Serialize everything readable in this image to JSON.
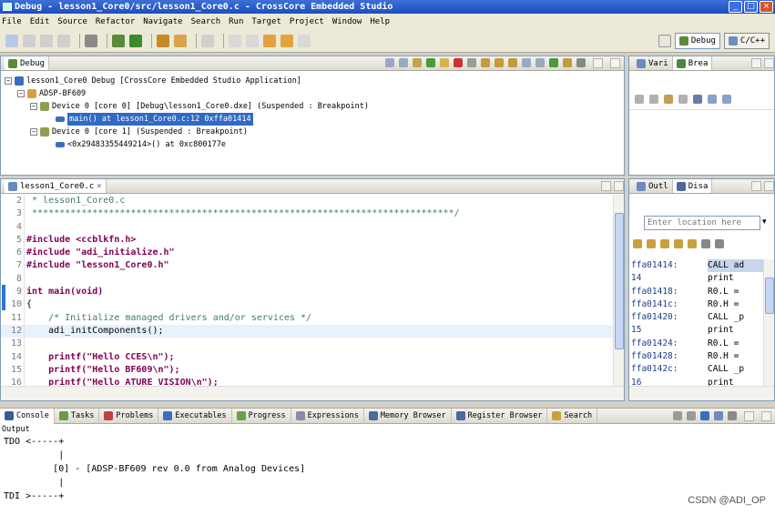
{
  "window": {
    "title": "Debug - lesson1_Core0/src/lesson1_Core0.c - CrossCore Embedded Studio",
    "controls": [
      "_",
      "□",
      "×"
    ]
  },
  "menu": [
    "File",
    "Edit",
    "Source",
    "Refactor",
    "Navigate",
    "Search",
    "Run",
    "Target",
    "Project",
    "Window",
    "Help"
  ],
  "perspectives": {
    "debug": "Debug",
    "cpp": "C/C++"
  },
  "debug_view": {
    "tab": "Debug",
    "tree": [
      "lesson1_Core0 Debug [CrossCore Embedded Studio Application]",
      "ADSP-BF609",
      "Device 0 [core 0] [Debug\\lesson1_Core0.dxe] (Suspended : Breakpoint)",
      "main() at lesson1_Core0.c:12 0xffa01414",
      "Device 0 [core 1] (Suspended : Breakpoint)",
      "<0x29483355449214>() at 0xc800177e"
    ]
  },
  "vars_view": {
    "tabs": [
      "Vari",
      "Brea"
    ]
  },
  "editor": {
    "tab": "lesson1_Core0.c",
    "lines": [
      {
        "n": "2",
        "t": " * lesson1_Core0.c"
      },
      {
        "n": "3",
        "t": " *****************************************************************************/"
      },
      {
        "n": "4",
        "t": ""
      },
      {
        "n": "5",
        "t": "#include <ccblkfn.h>"
      },
      {
        "n": "6",
        "t": "#include \"adi_initialize.h\""
      },
      {
        "n": "7",
        "t": "#include \"lesson1_Core0.h\""
      },
      {
        "n": "8",
        "t": ""
      },
      {
        "n": "9",
        "t": "int main(void)"
      },
      {
        "n": "10",
        "t": "{"
      },
      {
        "n": "11",
        "t": "    /* Initialize managed drivers and/or services */"
      },
      {
        "n": "12",
        "t": "    adi_initComponents();"
      },
      {
        "n": "13",
        "t": ""
      },
      {
        "n": "14",
        "t": "    printf(\"Hello CCES\\n\");"
      },
      {
        "n": "15",
        "t": "    printf(\"Hello BF609\\n\");"
      },
      {
        "n": "16",
        "t": "    printf(\"Hello ATURE VISION\\n\");"
      }
    ]
  },
  "side_panel": {
    "tabs": [
      "Outl",
      "Disa"
    ],
    "location_placeholder": "Enter location here",
    "rows": [
      {
        "a": "ffa01414:",
        "i": "CALL ad"
      },
      {
        "a": "14",
        "i": "print"
      },
      {
        "a": "ffa01418:",
        "i": "R0.L ="
      },
      {
        "a": "ffa0141c:",
        "i": "R0.H ="
      },
      {
        "a": "ffa01420:",
        "i": "CALL _p"
      },
      {
        "a": "15",
        "i": "print"
      },
      {
        "a": "ffa01424:",
        "i": "R0.L ="
      },
      {
        "a": "ffa01428:",
        "i": "R0.H ="
      },
      {
        "a": "ffa0142c:",
        "i": "CALL _p"
      },
      {
        "a": "16",
        "i": "print"
      }
    ]
  },
  "bottom_tabs": [
    "Console",
    "Tasks",
    "Problems",
    "Executables",
    "Progress",
    "Expressions",
    "Memory Browser",
    "Register Browser",
    "Search"
  ],
  "console": {
    "label": "Output",
    "lines": [
      "TDO <-----+",
      "          |",
      "         [0] - [ADSP-BF609 rev 0.0 from Analog Devices]",
      "          |",
      "TDI >-----+"
    ]
  },
  "watermark": "CSDN @ADI_OP"
}
